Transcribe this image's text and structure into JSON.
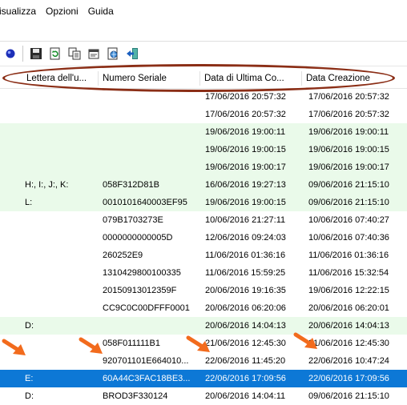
{
  "menu": {
    "items": [
      "isualizza",
      "Opzioni",
      "Guida"
    ]
  },
  "toolbar": {
    "buttons": [
      {
        "name": "refresh-dot-icon"
      },
      {
        "name": "save-icon"
      },
      {
        "name": "refresh-document-icon"
      },
      {
        "name": "copy-icon"
      },
      {
        "name": "properties-icon"
      },
      {
        "name": "html-report-icon"
      },
      {
        "name": "exit-icon"
      }
    ]
  },
  "columns": [
    "Lettera dell'u...",
    "Numero Seriale",
    "Data di Ultima Co...",
    "Data Creazione"
  ],
  "annotation": {
    "ellipse_color": "#8b2e16",
    "arrow_color": "#f26b1d"
  },
  "colors": {
    "row_green": "#eafaea",
    "selected": "#0d78d6"
  },
  "rows": [
    {
      "letter": "",
      "serial": "",
      "last": "17/06/2016 20:57:32",
      "created": "17/06/2016 20:57:32",
      "style": "white"
    },
    {
      "letter": "",
      "serial": "",
      "last": "17/06/2016 20:57:32",
      "created": "17/06/2016 20:57:32",
      "style": "white"
    },
    {
      "letter": "",
      "serial": "",
      "last": "19/06/2016 19:00:11",
      "created": "19/06/2016 19:00:11",
      "style": "green"
    },
    {
      "letter": "",
      "serial": "",
      "last": "19/06/2016 19:00:15",
      "created": "19/06/2016 19:00:15",
      "style": "green"
    },
    {
      "letter": "",
      "serial": "",
      "last": "19/06/2016 19:00:17",
      "created": "19/06/2016 19:00:17",
      "style": "green"
    },
    {
      "letter": "H:, I:, J:, K:",
      "serial": "058F312D81B",
      "last": "16/06/2016 19:27:13",
      "created": "09/06/2016 21:15:10",
      "style": "green"
    },
    {
      "letter": "L:",
      "serial": "0010101640003EF95",
      "last": "19/06/2016 19:00:15",
      "created": "09/06/2016 21:15:10",
      "style": "green"
    },
    {
      "letter": "",
      "serial": "079B1703273E",
      "last": "10/06/2016 21:27:11",
      "created": "10/06/2016 07:40:27",
      "style": "white"
    },
    {
      "letter": "",
      "serial": "0000000000005D",
      "last": "12/06/2016 09:24:03",
      "created": "10/06/2016 07:40:36",
      "style": "white"
    },
    {
      "letter": "",
      "serial": "260252E9",
      "last": "11/06/2016 01:36:16",
      "created": "11/06/2016 01:36:16",
      "style": "white"
    },
    {
      "letter": "",
      "serial": "1310429800100335",
      "last": "11/06/2016 15:59:25",
      "created": "11/06/2016 15:32:54",
      "style": "white"
    },
    {
      "letter": "",
      "serial": "20150913012359F",
      "last": "20/06/2016 19:16:35",
      "created": "19/06/2016 12:22:15",
      "style": "white"
    },
    {
      "letter": "",
      "serial": "CC9C0C00DFFF0001",
      "last": "20/06/2016 06:20:06",
      "created": "20/06/2016 06:20:01",
      "style": "white"
    },
    {
      "letter": "D:",
      "serial": "",
      "last": "20/06/2016 14:04:13",
      "created": "20/06/2016 14:04:13",
      "style": "green"
    },
    {
      "letter": "",
      "serial": "058F011111B1",
      "last": "21/06/2016 12:45:30",
      "created": "21/06/2016 12:45:30",
      "style": "white"
    },
    {
      "letter": "",
      "serial": "920701101E664010...",
      "last": "22/06/2016 11:45:20",
      "created": "22/06/2016 10:47:24",
      "style": "white"
    },
    {
      "letter": "E:",
      "serial": "60A44C3FAC18BE3...",
      "last": "22/06/2016 17:09:56",
      "created": "22/06/2016 17:09:56",
      "style": "selected"
    },
    {
      "letter": "D:",
      "serial": "BROD3F330124",
      "last": "20/06/2016 14:04:11",
      "created": "09/06/2016 21:15:10",
      "style": "white"
    }
  ]
}
